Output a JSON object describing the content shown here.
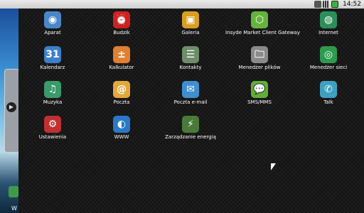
{
  "status": {
    "time": "14:52"
  },
  "widget": {
    "text": "W"
  },
  "apps": [
    {
      "label": "Aparat",
      "icon": "camera-icon",
      "glyph": "◉",
      "color": "#4a86c8"
    },
    {
      "label": "Budzik",
      "icon": "alarm-clock-icon",
      "glyph": "⏰",
      "color": "#d02020"
    },
    {
      "label": "Galeria",
      "icon": "gallery-icon",
      "glyph": "▣",
      "color": "#d8a020"
    },
    {
      "label": "Insyde Market Client Gateway",
      "icon": "market-icon",
      "glyph": "⬡",
      "color": "#64b43c"
    },
    {
      "label": "Internet",
      "icon": "globe-icon",
      "glyph": "◍",
      "color": "#2c8f5a"
    },
    {
      "label": "Kalendarz",
      "icon": "calendar-icon",
      "glyph": "31",
      "color": "#3e7fc9"
    },
    {
      "label": "Kalkulator",
      "icon": "calculator-icon",
      "glyph": "±",
      "color": "#e08030"
    },
    {
      "label": "Kontakty",
      "icon": "contacts-icon",
      "glyph": "☰",
      "color": "#6f8d6a"
    },
    {
      "label": "Menedżer plików",
      "icon": "file-manager-icon",
      "glyph": "🗀",
      "color": "#8a8a8a"
    },
    {
      "label": "Menedżer sieci",
      "icon": "network-icon",
      "glyph": "◎",
      "color": "#2f9a4f"
    },
    {
      "label": "Muzyka",
      "icon": "music-icon",
      "glyph": "♫",
      "color": "#3a9a6a"
    },
    {
      "label": "Poczta",
      "icon": "mail-icon",
      "glyph": "@",
      "color": "#e2a83a"
    },
    {
      "label": "Poczta e-mail",
      "icon": "email-icon",
      "glyph": "✉",
      "color": "#3f8fcf"
    },
    {
      "label": "SMS/MMS",
      "icon": "sms-icon",
      "glyph": "💬",
      "color": "#5fb036"
    },
    {
      "label": "Talk",
      "icon": "talk-icon",
      "glyph": "✆",
      "color": "#3fa0c0"
    },
    {
      "label": "Ustawienia",
      "icon": "settings-icon",
      "glyph": "⚙",
      "color": "#c03030"
    },
    {
      "label": "WWW",
      "icon": "www-icon",
      "glyph": "◐",
      "color": "#2a78c8"
    },
    {
      "label": "Zarządzanie energią",
      "icon": "power-management-icon",
      "glyph": "⚡",
      "color": "#4a7a3a"
    }
  ]
}
